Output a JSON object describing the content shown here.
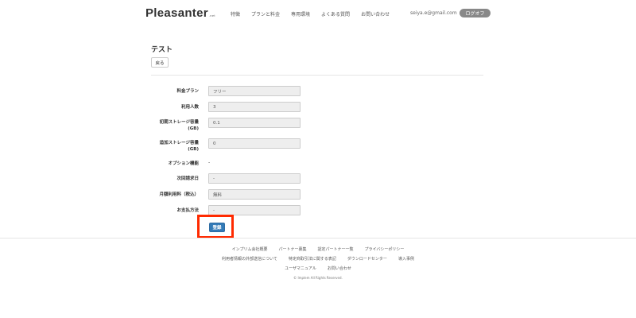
{
  "header": {
    "logo": "Pleasanter",
    "logo_suffix": ".net",
    "nav": [
      "特徴",
      "プランと料金",
      "専用環境",
      "よくある質問",
      "お問い合わせ"
    ],
    "user_email": "seiya.e@gmail.com",
    "logout": "ログオフ"
  },
  "page": {
    "title": "テスト",
    "back": "戻る"
  },
  "form": {
    "plan_label": "料金プラン",
    "plan_value": "フリー",
    "users_label": "利用人数",
    "users_value": "3",
    "initial_storage_label_1": "初期ストレージ容量",
    "initial_storage_label_2": "(GB)",
    "initial_storage_value": "0.1",
    "additional_storage_label_1": "追加ストレージ容量",
    "additional_storage_label_2": "(GB)",
    "additional_storage_value": "0",
    "option_label": "オプション機能",
    "option_value": "-",
    "next_billing_label": "次回請求日",
    "next_billing_value": "-",
    "monthly_fee_label": "月額利用料（税込）",
    "monthly_fee_value": "無料",
    "payment_label": "お支払方法",
    "payment_value": "-",
    "register": "登録"
  },
  "footer": {
    "row1": [
      "インプリム会社概要",
      "パートナー募集",
      "認定パートナー一覧",
      "プライバシーポリシー"
    ],
    "row2": [
      "利用者情報の外部送信について",
      "特定商取引法に関する表記",
      "ダウンロードセンター",
      "導入事例"
    ],
    "row3": [
      "ユーザマニュアル",
      "お問い合わせ"
    ],
    "copyright": "© Implem All Rights Reserved."
  }
}
